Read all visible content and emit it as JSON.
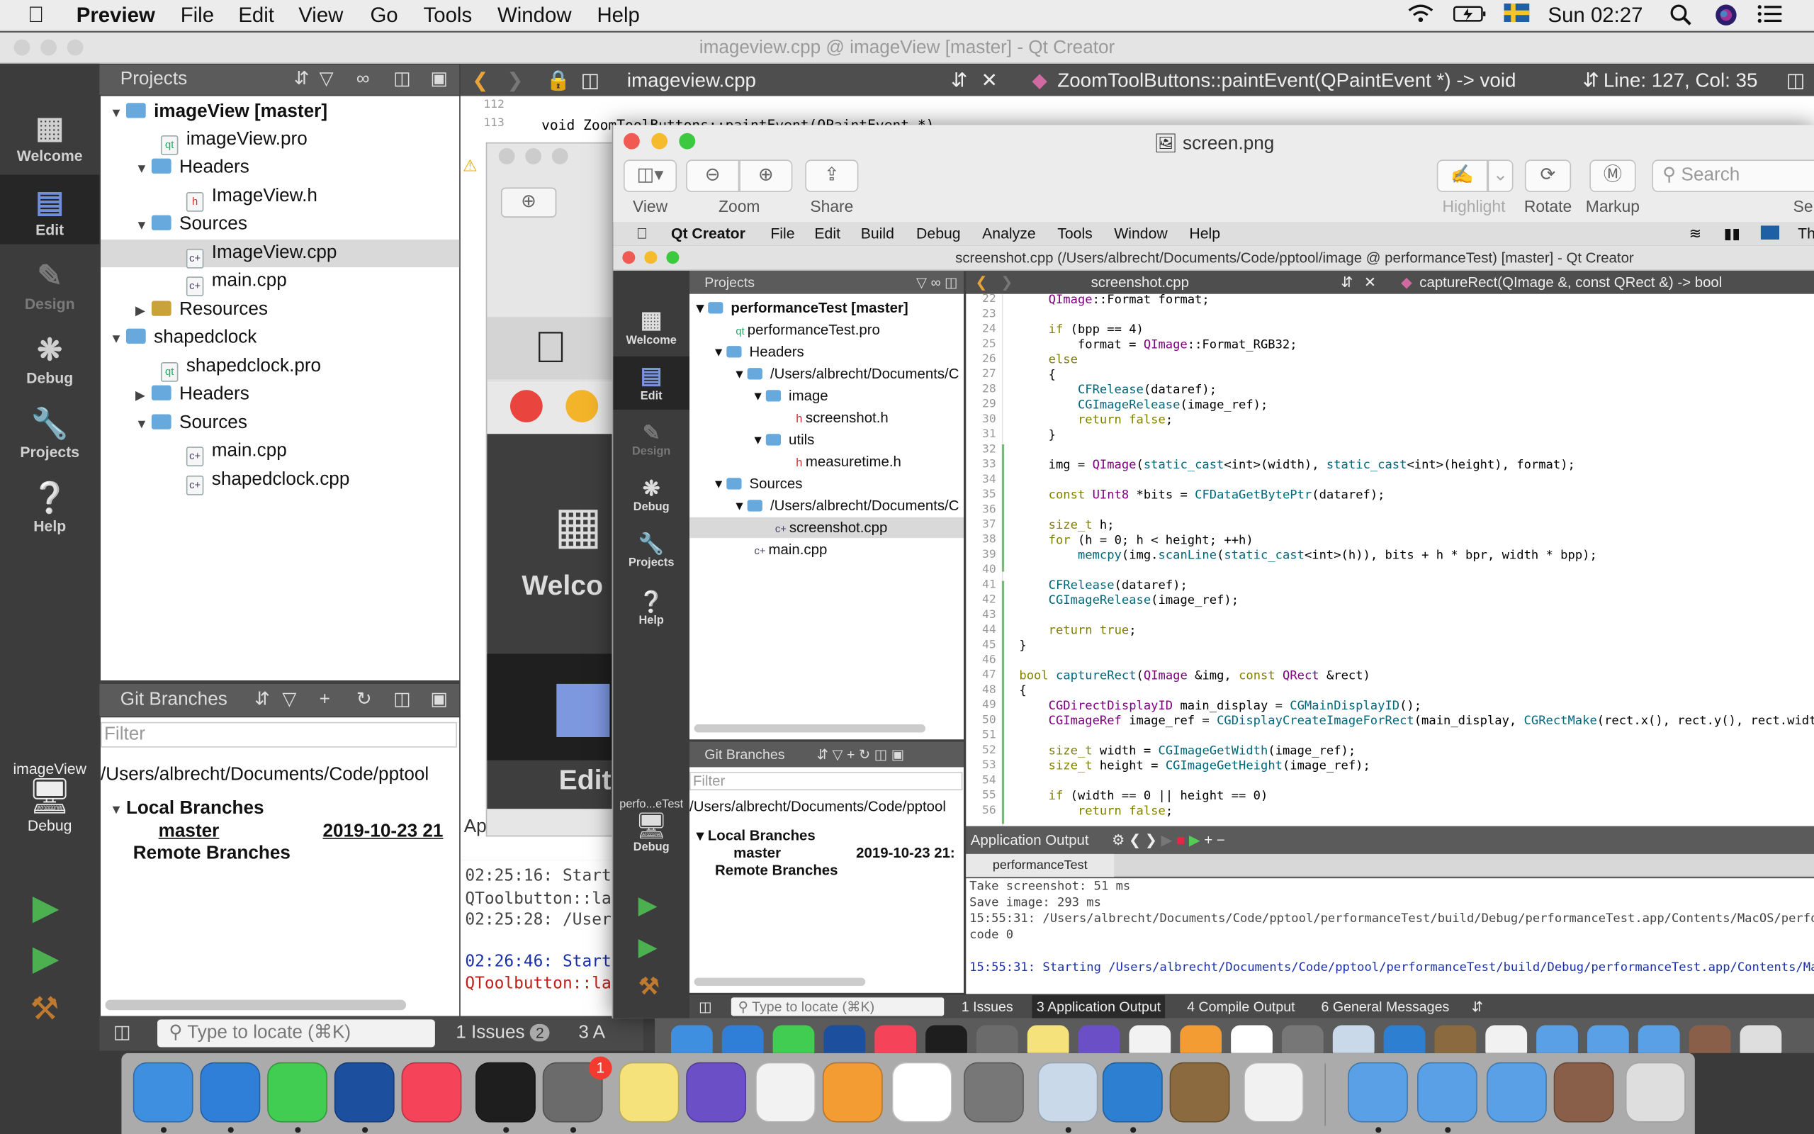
{
  "menubar": {
    "app": "Preview",
    "items": [
      "File",
      "Edit",
      "View",
      "Go",
      "Tools",
      "Window",
      "Help"
    ],
    "clock": "Sun 02:27"
  },
  "qt_bg": {
    "title": "imageview.cpp @ imageView [master] - Qt Creator",
    "modes": {
      "welcome": "Welcome",
      "edit": "Edit",
      "design": "Design",
      "debug": "Debug",
      "projects": "Projects",
      "help": "Help"
    },
    "projects_header": "Projects",
    "tree": {
      "p1": "imageView [master]",
      "p1_pro": "imageView.pro",
      "headers": "Headers",
      "h1": "ImageView.h",
      "sources": "Sources",
      "cpp1": "ImageView.cpp",
      "main": "main.cpp",
      "resources": "Resources",
      "p2": "shapedclock",
      "p2_pro": "shapedclock.pro",
      "headers2": "Headers",
      "sources2": "Sources",
      "main2": "main.cpp",
      "cpp2": "shapedclock.cpp"
    },
    "git": {
      "header": "Git Branches",
      "filter_placeholder": "Filter",
      "path": "/Users/albrecht/Documents/Code/pptool",
      "local": "Local Branches",
      "master": "master",
      "date": "2019-10-23 21",
      "remote": "Remote Branches"
    },
    "kit": {
      "name": "imageView",
      "mode": "Debug"
    },
    "editor": {
      "file": "imageview.cpp",
      "func": "ZoomToolButtons::paintEvent(QPaintEvent *) -> void",
      "pos": "Line: 127, Col: 35",
      "l112": "112",
      "l113": "113",
      "code113": "void ZoomToolButtons::paintEvent(QPaintEvent *)"
    },
    "output": {
      "o1": "02:25:16: Starti",
      "o2": "QToolbutton::lab",
      "o3": "02:25:28: /Users",
      "o4": "02:26:46: Starti",
      "o5": "QToolbutton::lab"
    },
    "locator": "Type to locate (⌘K)",
    "bottom": {
      "issues": "1  Issues",
      "issues_count": "2",
      "app": "3  A"
    },
    "mid_welcome": "Welco",
    "mid_edit": "Edit",
    "mid_ap": "Ap"
  },
  "preview": {
    "title": "screen.png",
    "toolbar": {
      "view": "View",
      "zoom": "Zoom",
      "share": "Share",
      "highlight": "Highlight",
      "rotate": "Rotate",
      "markup": "Markup",
      "search": "Search",
      "se": "Se"
    }
  },
  "shot": {
    "menubar": {
      "app": "Qt Creator",
      "items": [
        "File",
        "Edit",
        "Build",
        "Debug",
        "Analyze",
        "Tools",
        "Window",
        "Help"
      ],
      "th": "Th"
    },
    "title": "screenshot.cpp (/Users/albrecht/Documents/Code/pptool/image @ performanceTest) [master] - Qt Creator",
    "modes": {
      "welcome": "Welcome",
      "edit": "Edit",
      "design": "Design",
      "debug": "Debug",
      "projects": "Projects",
      "help": "Help"
    },
    "projects_header": "Projects",
    "tree": {
      "p": "performanceTest [master]",
      "pro": "performanceTest.pro",
      "headers": "Headers",
      "path1": "/Users/albrecht/Documents/C",
      "image": "image",
      "h": "screenshot.h",
      "utils": "utils",
      "mh": "measuretime.h",
      "sources": "Sources",
      "path2": "/Users/albrecht/Documents/C",
      "cpp": "screenshot.cpp",
      "main": "main.cpp"
    },
    "git": {
      "header": "Git Branches",
      "filter": "Filter",
      "path": "/Users/albrecht/Documents/Code/pptool",
      "local": "Local Branches",
      "master": "master",
      "date": "2019-10-23 21:",
      "remote": "Remote Branches"
    },
    "kit": {
      "name": "perfo...eTest",
      "mode": "Debug"
    },
    "editor": {
      "file": "screenshot.cpp",
      "func": "captureRect(QImage &, const QRect &) -> bool"
    },
    "code": [
      [
        "22",
        "    QImage::Format format;"
      ],
      [
        "23",
        ""
      ],
      [
        "24",
        "    if (bpp == 4)"
      ],
      [
        "25",
        "        format = QImage::Format_RGB32;"
      ],
      [
        "26",
        "    else"
      ],
      [
        "27",
        "    {"
      ],
      [
        "28",
        "        CFRelease(dataref);"
      ],
      [
        "29",
        "        CGImageRelease(image_ref);"
      ],
      [
        "30",
        "        return false;"
      ],
      [
        "31",
        "    }"
      ],
      [
        "32",
        ""
      ],
      [
        "33",
        "    img = QImage(static_cast<int>(width), static_cast<int>(height), format);"
      ],
      [
        "34",
        ""
      ],
      [
        "35",
        "    const UInt8 *bits = CFDataGetBytePtr(dataref);"
      ],
      [
        "36",
        ""
      ],
      [
        "37",
        "    size_t h;"
      ],
      [
        "38",
        "    for (h = 0; h < height; ++h)"
      ],
      [
        "39",
        "        memcpy(img.scanLine(static_cast<int>(h)), bits + h * bpr, width * bpp);"
      ],
      [
        "40",
        ""
      ],
      [
        "41",
        "    CFRelease(dataref);"
      ],
      [
        "42",
        "    CGImageRelease(image_ref);"
      ],
      [
        "43",
        ""
      ],
      [
        "44",
        "    return true;"
      ],
      [
        "45",
        "}"
      ],
      [
        "46",
        ""
      ],
      [
        "47",
        "bool captureRect(QImage &img, const QRect &rect)"
      ],
      [
        "48",
        "{"
      ],
      [
        "49",
        "    CGDirectDisplayID main_display = CGMainDisplayID();"
      ],
      [
        "50",
        "    CGImageRef image_ref = CGDisplayCreateImageForRect(main_display, CGRectMake(rect.x(), rect.y(), rect.width(), rect.hei"
      ],
      [
        "51",
        ""
      ],
      [
        "52",
        "    size_t width = CGImageGetWidth(image_ref);"
      ],
      [
        "53",
        "    size_t height = CGImageGetHeight(image_ref);"
      ],
      [
        "54",
        ""
      ],
      [
        "55",
        "    if (width == 0 || height == 0)"
      ],
      [
        "56",
        "        return false;"
      ]
    ],
    "output": {
      "header": "Application Output",
      "tab": "performanceTest",
      "l1": "Take screenshot: 51 ms",
      "l2": "Save image: 293 ms",
      "l3": "15:55:31: /Users/albrecht/Documents/Code/pptool/performanceTest/build/Debug/performanceTest.app/Contents/MacOS/perform",
      "l4": "code 0",
      "l5": "15:55:31: Starting /Users/albrecht/Documents/Code/pptool/performanceTest/build/Debug/performanceTest.app/Contents/MacO"
    },
    "locator": "Type to locate (⌘K)",
    "bottom": {
      "b1": "1  Issues",
      "b3": "3  Application Output",
      "b4": "4  Compile Output",
      "b6": "6  General Messages"
    }
  },
  "dock": {
    "apps": [
      "finder-icon",
      "safari-icon",
      "qt-creator-icon",
      "quicktime-icon",
      "music-icon",
      "terminal-icon",
      "system-preferences-icon",
      "notes-icon",
      "imovie-icon",
      "reminders-icon",
      "pages-icon",
      "photos-icon",
      "calculator-icon",
      "preview-icon",
      "xcode-icon",
      "gimp-icon",
      "textedit-icon",
      "document-icon",
      "document-icon",
      "document-icon",
      "photo-thumbnail-icon",
      "trash-icon"
    ],
    "badge": "1"
  }
}
